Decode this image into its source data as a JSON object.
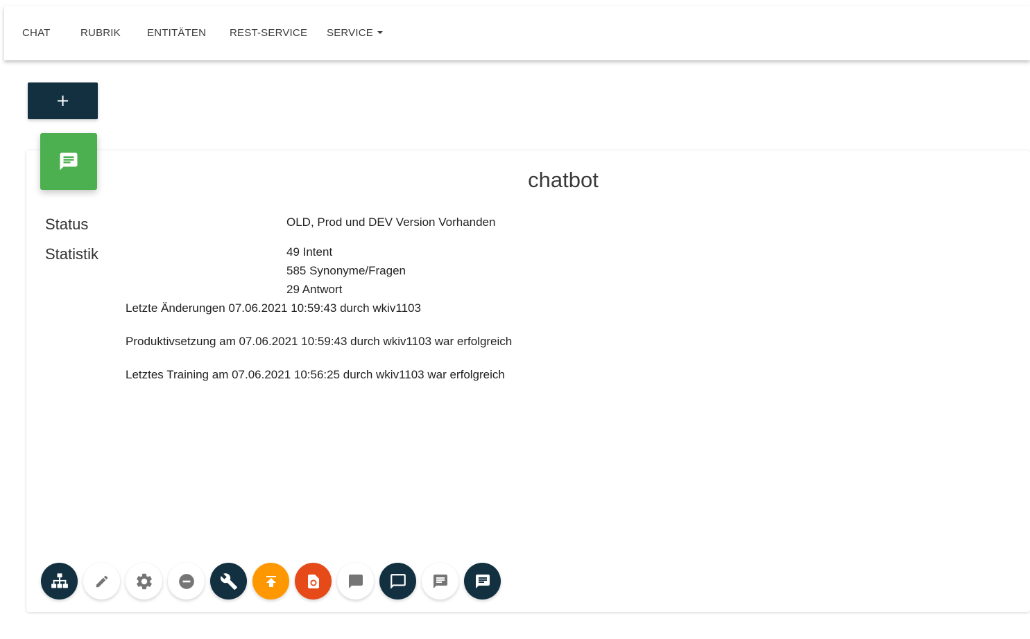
{
  "nav": {
    "items": [
      {
        "label": "CHAT"
      },
      {
        "label": "RUBRIK"
      },
      {
        "label": "ENTITÄTEN"
      },
      {
        "label": "REST-SERVICE"
      },
      {
        "label": "SERVICE",
        "dropdown": true
      }
    ]
  },
  "add_button": {
    "label": "+"
  },
  "card": {
    "title": "chatbot",
    "icon": "chat-message-icon",
    "status_label": "Status",
    "status_value": "OLD, Prod und DEV Version Vorhanden",
    "statistik_label": "Statistik",
    "statistik_values": [
      "49 Intent",
      "585 Synonyme/Fragen",
      "29 Antwort"
    ],
    "info_lines": [
      "Letzte Änderungen 07.06.2021 10:59:43 durch wkiv1103",
      "Produktivsetzung am 07.06.2021 10:59:43 durch wkiv1103 war erfolgreich",
      "Letztes Training am 07.06.2021 10:56:25 durch wkiv1103 war erfolgreich"
    ]
  },
  "actions": [
    {
      "icon": "sitemap-icon",
      "style": "dark"
    },
    {
      "icon": "edit-icon",
      "style": "light"
    },
    {
      "icon": "gear-icon",
      "style": "light"
    },
    {
      "icon": "minus-circle-icon",
      "style": "light"
    },
    {
      "icon": "wrench-icon",
      "style": "dark"
    },
    {
      "icon": "publish-icon",
      "style": "orange"
    },
    {
      "icon": "restore-icon",
      "style": "red"
    },
    {
      "icon": "chat-bubble-icon",
      "style": "light"
    },
    {
      "icon": "chat-outline-icon",
      "style": "dark"
    },
    {
      "icon": "message-text-icon",
      "style": "light"
    },
    {
      "icon": "message-text-icon",
      "style": "dark"
    }
  ],
  "colors": {
    "navy": "#133041",
    "green": "#4caf50",
    "orange": "#ff9800",
    "red": "#e64a19"
  }
}
